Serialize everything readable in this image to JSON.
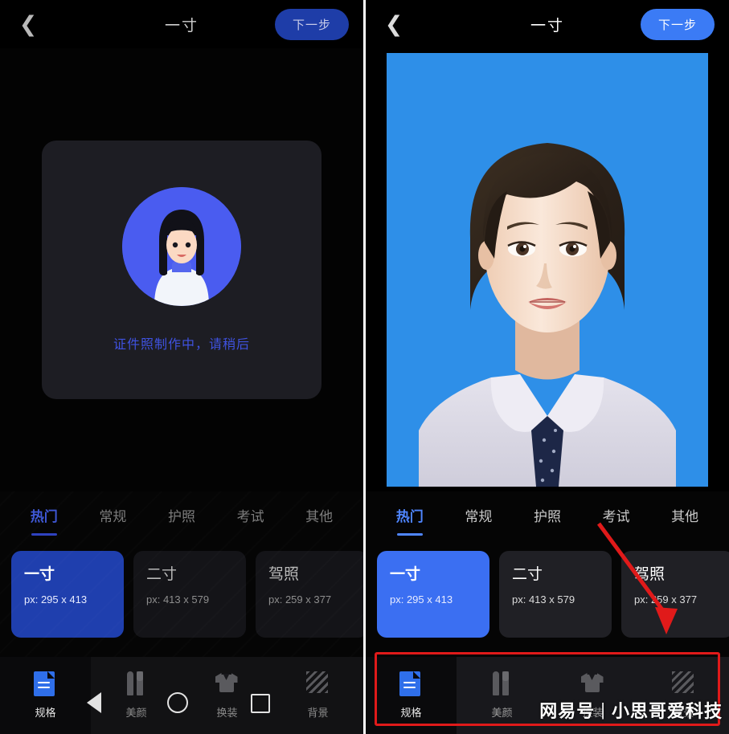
{
  "app": {
    "header": {
      "back_icon": "chevron-left-icon",
      "title": "一寸",
      "next_label": "下一步"
    },
    "loading": {
      "text": "证件照制作中，请稍后",
      "avatar_icon": "user-avatar-placeholder-icon",
      "accent": "#4a5cf0",
      "text_color": "#3f52e0"
    },
    "tabs": [
      {
        "label": "热门",
        "active": true
      },
      {
        "label": "常规",
        "active": false
      },
      {
        "label": "护照",
        "active": false
      },
      {
        "label": "考试",
        "active": false
      },
      {
        "label": "其他",
        "active": false
      }
    ],
    "sizes": [
      {
        "name": "一寸",
        "px": "px: 295 x 413",
        "selected": true
      },
      {
        "name": "二寸",
        "px": "px: 413 x 579",
        "selected": false
      },
      {
        "name": "驾照",
        "px": "px: 259 x 377",
        "selected": false
      }
    ],
    "bottom_nav": [
      {
        "label": "规格",
        "icon": "document-icon",
        "active": true
      },
      {
        "label": "美颜",
        "icon": "makeup-brush-icon",
        "active": false
      },
      {
        "label": "换装",
        "icon": "shirt-icon",
        "active": false
      },
      {
        "label": "背景",
        "icon": "stripes-background-icon",
        "active": false
      }
    ],
    "system_nav": [
      {
        "icon": "android-back-icon"
      },
      {
        "icon": "android-home-icon"
      },
      {
        "icon": "android-recents-icon"
      }
    ],
    "photo": {
      "alt": "id-photo-woman-blue-background",
      "background_color": "#2e8fe8"
    },
    "annotation": {
      "highlight_color": "#e01a1a",
      "arrow_icon": "red-down-arrow-annotation"
    },
    "watermark": {
      "brand": "网易号",
      "separator": "|",
      "author": "小思哥爱科技"
    },
    "colors": {
      "selected_card_left": "#1f3fae",
      "selected_card_right": "#3b6ff2",
      "next_button_left": "#1e3da8",
      "next_button_right": "#3b7bf5",
      "tab_active_right": "#4f86ff"
    }
  }
}
